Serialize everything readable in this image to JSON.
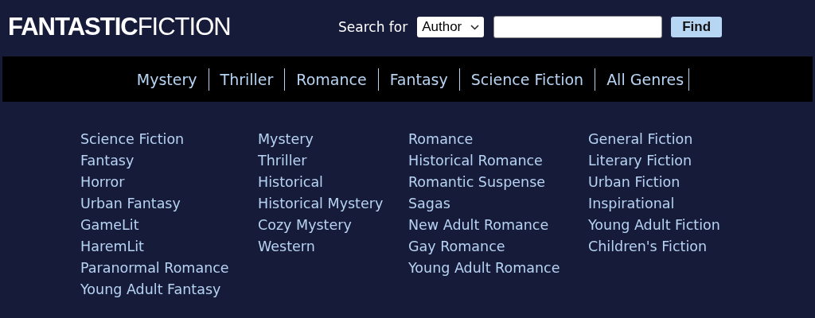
{
  "logo": "**FANTASTIC**FICTION",
  "search": {
    "label": "Search for",
    "type_value": "Author",
    "button": "Find"
  },
  "nav": [
    {
      "label": "Mystery"
    },
    {
      "label": "Thriller"
    },
    {
      "label": "Romance"
    },
    {
      "label": "Fantasy"
    },
    {
      "label": "Science Fiction"
    },
    {
      "label": "All Genres"
    }
  ],
  "genre_columns": [
    [
      "Science Fiction",
      "Fantasy",
      "Horror",
      "Urban Fantasy",
      "GameLit",
      "HaremLit",
      "Paranormal Romance",
      "Young Adult Fantasy"
    ],
    [
      "Mystery",
      "Thriller",
      "Historical",
      "Historical Mystery",
      "Cozy Mystery",
      "Western"
    ],
    [
      "Romance",
      "Historical Romance",
      "Romantic Suspense",
      "Sagas",
      "New Adult Romance",
      "Gay Romance",
      "Young Adult Romance"
    ],
    [
      "General Fiction",
      "Literary Fiction",
      "Urban Fiction",
      "Inspirational",
      "Young Adult Fiction",
      "Children's Fiction"
    ]
  ]
}
